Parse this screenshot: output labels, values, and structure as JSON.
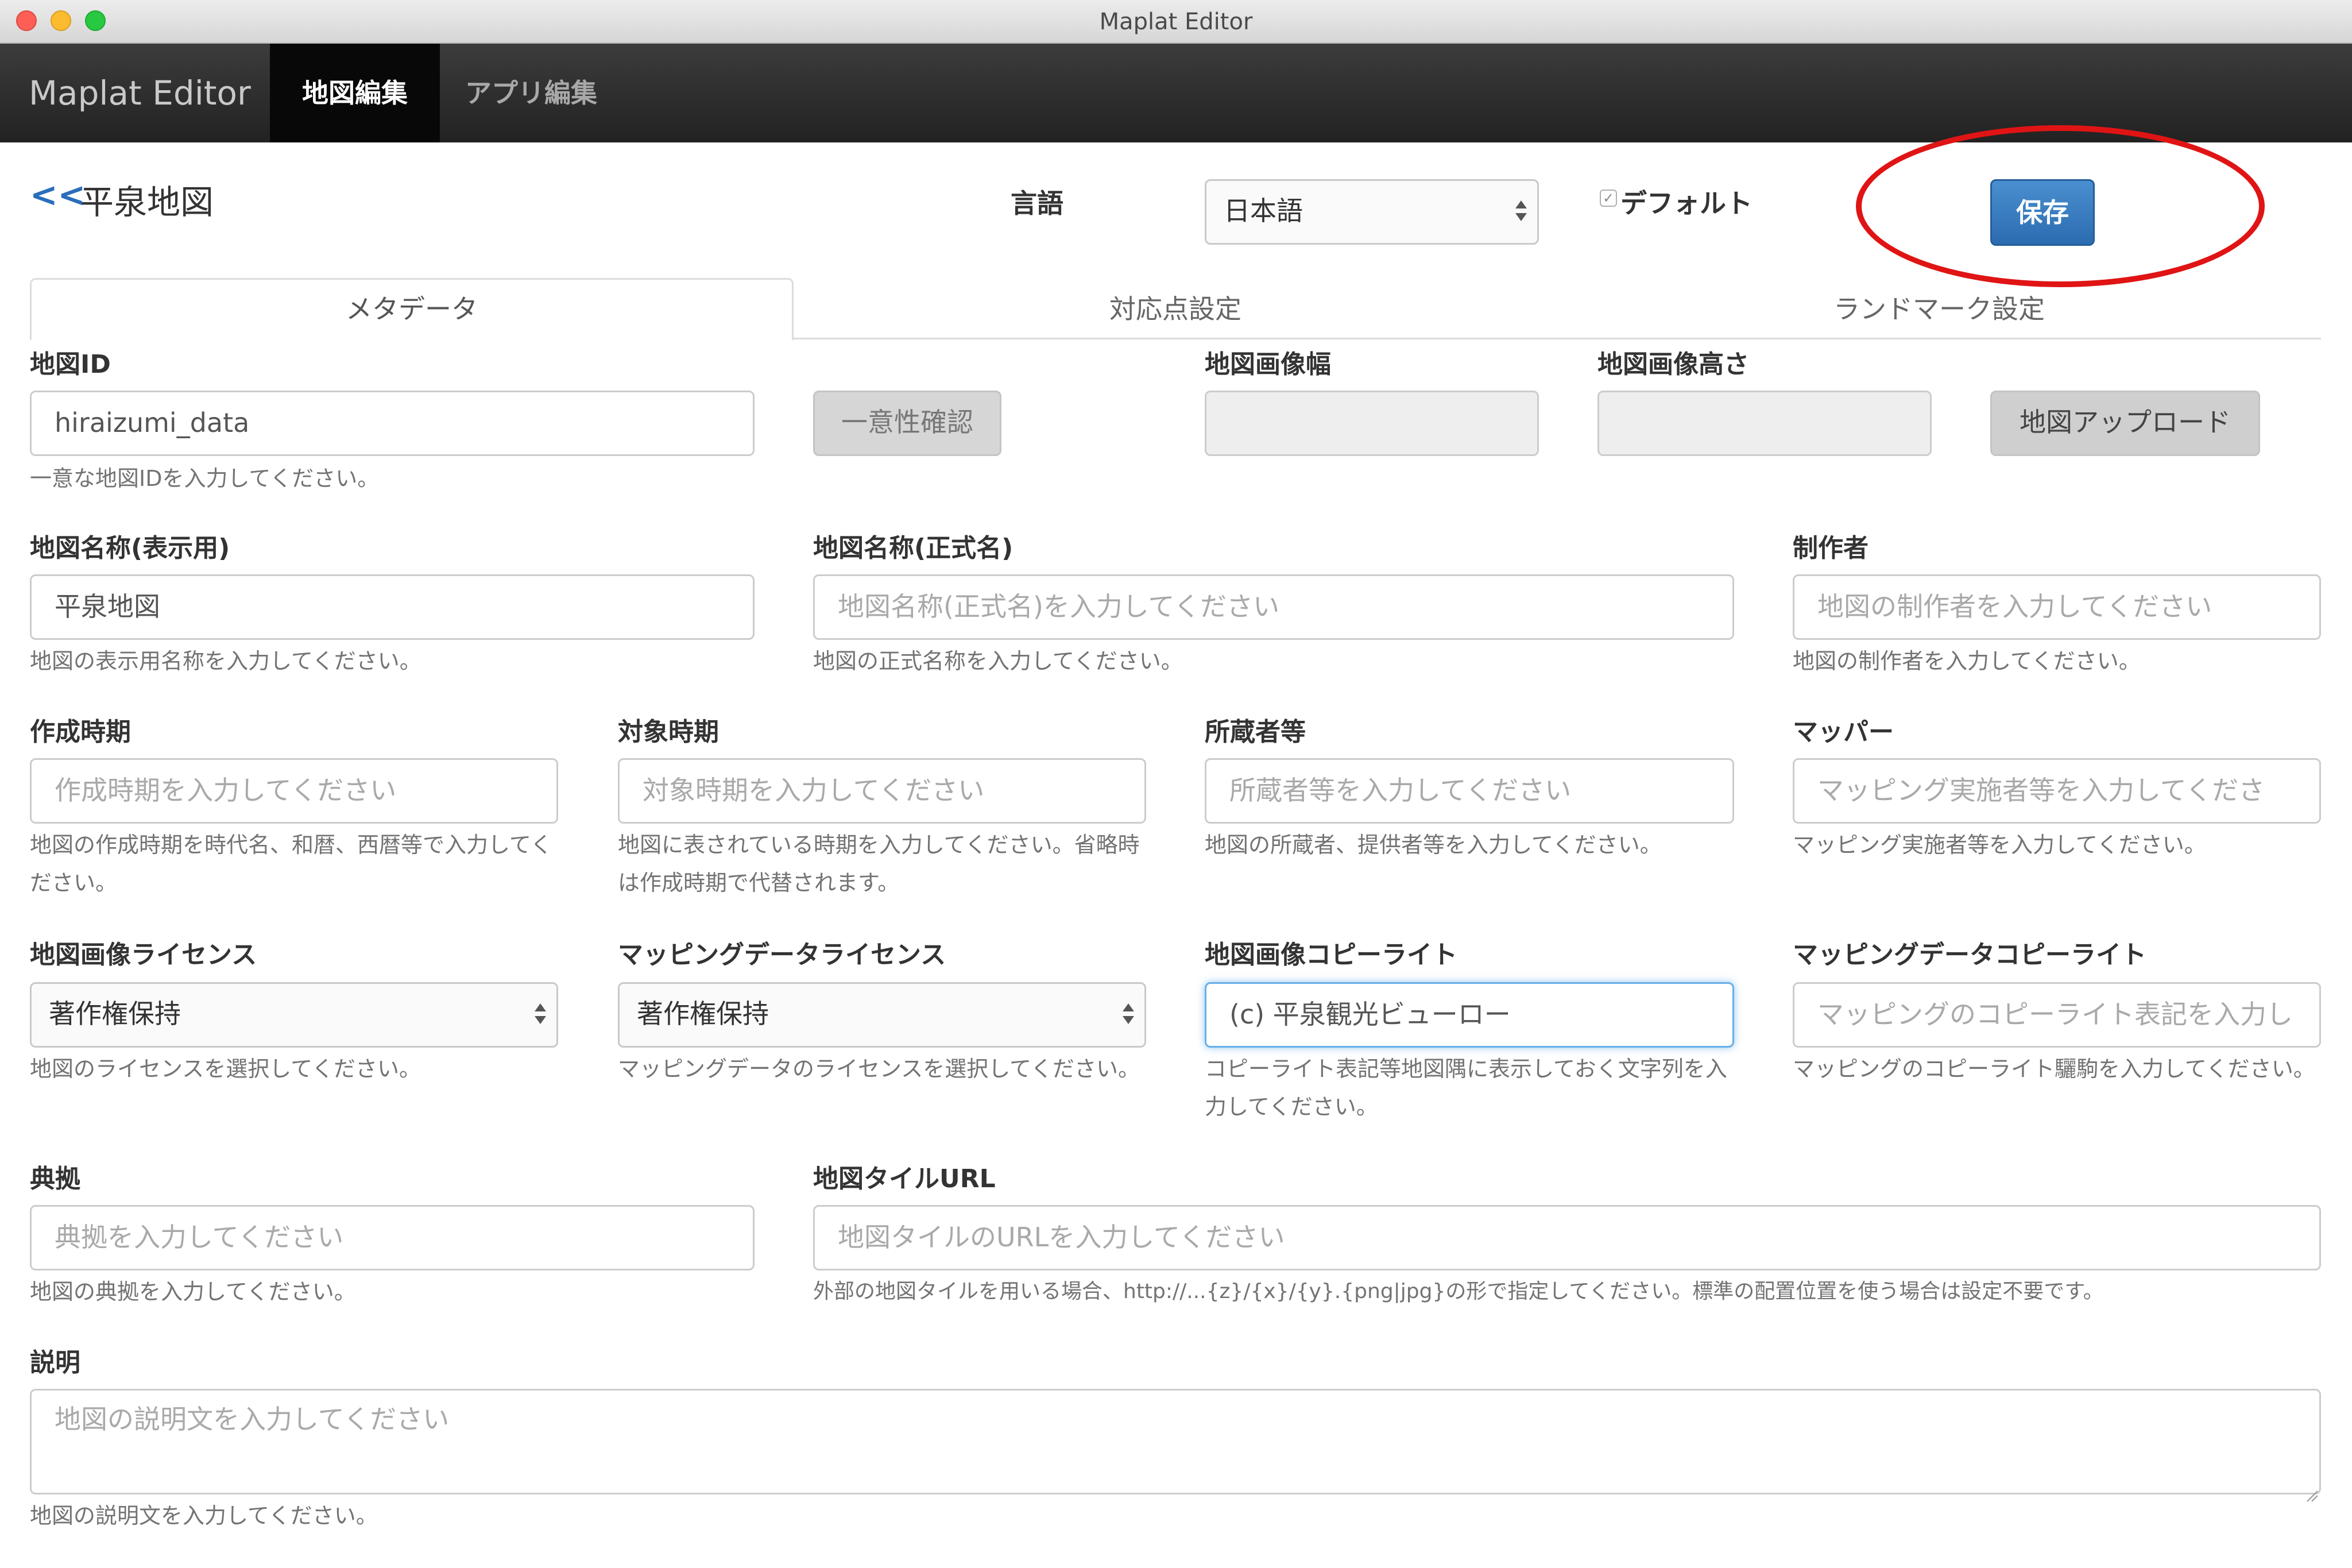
{
  "window": {
    "title": "Maplat Editor"
  },
  "navbar": {
    "brand": "Maplat Editor",
    "tabs": [
      {
        "label": "地図編集",
        "active": true
      },
      {
        "label": "アプリ編集",
        "active": false
      }
    ]
  },
  "header": {
    "back": "<<",
    "map_title": "平泉地図",
    "language_label": "言語",
    "language_value": "日本語",
    "default_label": "デフォルト",
    "default_checked": true,
    "save_label": "保存"
  },
  "tabs": [
    {
      "label": "メタデータ",
      "active": true
    },
    {
      "label": "対応点設定",
      "active": false
    },
    {
      "label": "ランドマーク設定",
      "active": false
    }
  ],
  "form": {
    "map_id": {
      "label": "地図ID",
      "value": "hiraizumi_data",
      "help": "一意な地図IDを入力してください。",
      "check_button": "一意性確認"
    },
    "image_width": {
      "label": "地図画像幅"
    },
    "image_height": {
      "label": "地図画像高さ"
    },
    "upload_button": "地図アップロード",
    "display_name": {
      "label": "地図名称(表示用)",
      "value": "平泉地図",
      "help": "地図の表示用名称を入力してください。"
    },
    "official_name": {
      "label": "地図名称(正式名)",
      "placeholder": "地図名称(正式名)を入力してください",
      "help": "地図の正式名称を入力してください。"
    },
    "author": {
      "label": "制作者",
      "placeholder": "地図の制作者を入力してください",
      "help": "地図の制作者を入力してください。"
    },
    "created": {
      "label": "作成時期",
      "placeholder": "作成時期を入力してください",
      "help": "地図の作成時期を時代名、和暦、西暦等で入力してください。"
    },
    "era": {
      "label": "対象時期",
      "placeholder": "対象時期を入力してください",
      "help": "地図に表されている時期を入力してください。省略時は作成時期で代替されます。"
    },
    "owner": {
      "label": "所蔵者等",
      "placeholder": "所蔵者等を入力してください",
      "help": "地図の所蔵者、提供者等を入力してください。"
    },
    "mapper": {
      "label": "マッパー",
      "placeholder": "マッピング実施者等を入力してくださ",
      "help": "マッピング実施者等を入力してください。"
    },
    "image_license": {
      "label": "地図画像ライセンス",
      "value": "著作権保持",
      "help": "地図のライセンスを選択してください。"
    },
    "data_license": {
      "label": "マッピングデータライセンス",
      "value": "著作権保持",
      "help": "マッピングデータのライセンスを選択してください。"
    },
    "image_copyright": {
      "label": "地図画像コピーライト",
      "value": "(c) 平泉観光ビューロー",
      "help": "コピーライト表記等地図隅に表示しておく文字列を入力してください。"
    },
    "data_copyright": {
      "label": "マッピングデータコピーライト",
      "placeholder": "マッピングのコピーライト表記を入力し",
      "help": "マッピングのコピーライト驪駒を入力してください。"
    },
    "source": {
      "label": "典拠",
      "placeholder": "典拠を入力してください",
      "help": "地図の典拠を入力してください。"
    },
    "tile_url": {
      "label": "地図タイルURL",
      "placeholder": "地図タイルのURLを入力してください",
      "help": "外部の地図タイルを用いる場合、http://...{z}/{x}/{y}.{png|jpg}の形で指定してください。標準の配置位置を使う場合は設定不要です。"
    },
    "description": {
      "label": "説明",
      "placeholder": "地図の説明文を入力してください",
      "help": "地図の説明文を入力してください。"
    }
  },
  "colors": {
    "accent": "#2a6ebb",
    "save": "#2b6cb0",
    "highlight": "#e01414",
    "navbar": "#2b2b2b"
  }
}
